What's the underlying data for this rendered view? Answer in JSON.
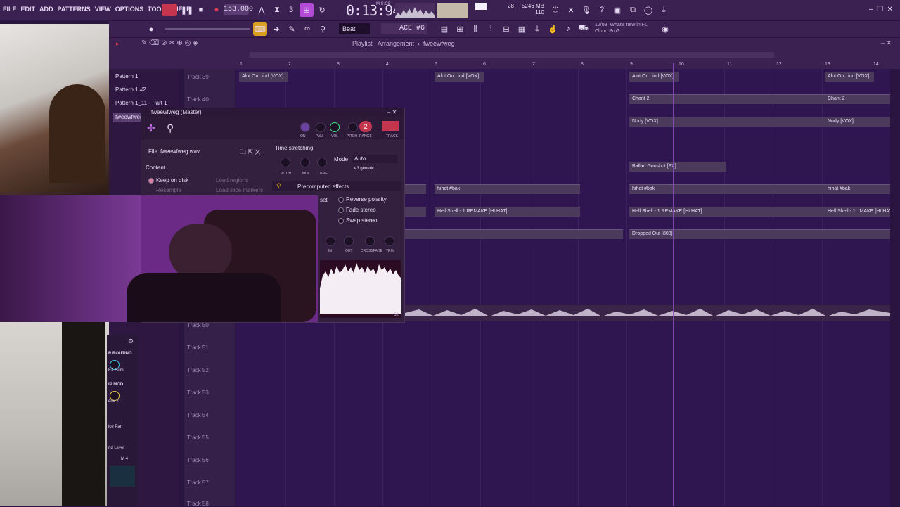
{
  "menu": [
    "FILE",
    "EDIT",
    "ADD",
    "PATTERNS",
    "VIEW",
    "OPTIONS",
    "TOOLS",
    "HELP"
  ],
  "transport": {
    "tempo": "153.000",
    "timecode": "0:13:94",
    "timecode_label": "M:S:CS"
  },
  "monitor": {
    "cpu": "28",
    "memory": "5246 MB",
    "polyphony": "110"
  },
  "toolbar": {
    "snap": "Beat",
    "pattern": "ACE #6"
  },
  "news": {
    "date": "12/09",
    "headline": "What's new in FL",
    "subline": "Cloud Pro?"
  },
  "playlist": {
    "breadcrumb": "Playlist - Arrangement",
    "arrangement": "fweewfweg",
    "bar_numbers": [
      "1",
      "2",
      "3",
      "4",
      "5",
      "6",
      "7",
      "8",
      "9",
      "10",
      "11",
      "12",
      "13",
      "14"
    ]
  },
  "patterns": [
    "Pattern 1",
    "Pattern 1 #2",
    "Pattern 1_11 - Part 1",
    "fweewfweg"
  ],
  "tracks": [
    "Track 39",
    "Track 40",
    "Track 50",
    "Track 51",
    "Track 52",
    "Track 53",
    "Track 54",
    "Track 55",
    "Track 56",
    "Track 57",
    "Track 58"
  ],
  "clips": {
    "vox1": "Alot On...ind [VOX]",
    "vox2": "Alot On...ind [VOX]",
    "vox3": "Alot On...ind [VOX]",
    "vox4": "Alot On...ind [VOX]",
    "chant1": "Chant 2",
    "chant2": "Chant 2",
    "nudy1": "Nudy [VOX]",
    "nudy2": "Nudy [VOX]",
    "gunshot": "Ballad Gunshot [FX]",
    "hihat1": "hihat #bak",
    "hihat2": "hihat #bak",
    "hihat3": "hihat #bak",
    "hell1": "Hell Shell - 1 REMAKE [HI HAT]",
    "hell2": "Hell Shell - 1 REMAKE [HI HAT]",
    "hell3": "Hell Shell - 1...MAKE [HI HAT]",
    "dropped": "Dropped Out [808]"
  },
  "channel": {
    "title": "fweewfweg (Master)",
    "track_num": "2",
    "knob_labels": [
      "ON",
      "PAN",
      "VOL",
      "PITCH",
      "RANGE",
      "TRACK"
    ],
    "file_label": "File",
    "file_name": "fweewfweg.wav",
    "content": "Content",
    "keep_on_disk": "Keep on disk",
    "resample": "Resample",
    "load_regions": "Load regions",
    "load_slice": "Load slice markers",
    "time_stretching": "Time stretching",
    "mode_label": "Mode",
    "mode_value": "Auto",
    "mode_sub": "e3 generic",
    "ts_knobs": [
      "PITCH",
      "MUL",
      "TIME"
    ],
    "precomputed": "Precomputed effects",
    "reset_frag": "set",
    "reverse": "Reverse polarity",
    "fade": "Fade stereo",
    "swap": "Swap stereo",
    "fx_knobs": [
      "IN",
      "OUT",
      "CROSSFADE",
      "TRIM"
    ],
    "wave_tag": "32"
  },
  "mixer_side": {
    "routing": "R ROUTING",
    "fx_sum": "FX Sum",
    "ip_mod": "IP MOD",
    "env": "env 2",
    "pan": "ice Pan",
    "level": "nd Level",
    "m4": "M 4"
  },
  "colors": {
    "bg": "#301650",
    "clip": "#4b3a5c",
    "playhead": "#8a4cc0",
    "accent": "#c4364e"
  }
}
